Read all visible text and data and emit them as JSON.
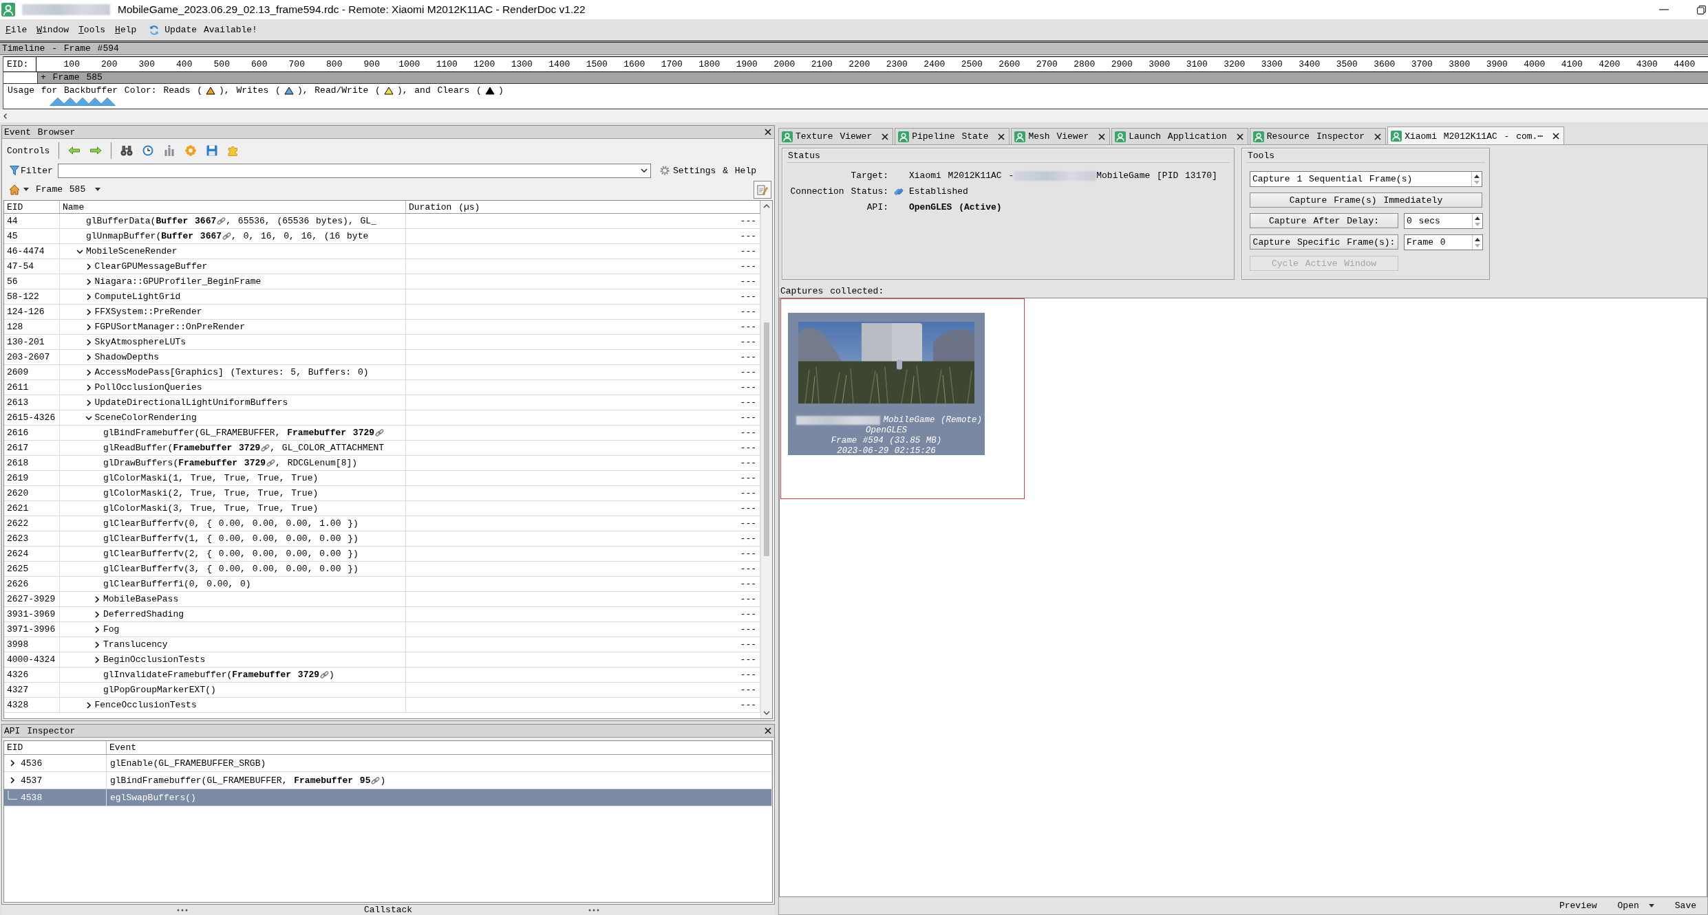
{
  "window": {
    "title": "MobileGame_2023.06.29_02.13_frame594.rdc - Remote: Xiaomi M2012K11AC - RenderDoc v1.22"
  },
  "menu": [
    "File",
    "Window",
    "Tools",
    "Help"
  ],
  "update_notice": "Update Available!",
  "timeline": {
    "title": "Timeline - Frame #594",
    "axis_label": "EID:",
    "ticks": [
      "100",
      "200",
      "300",
      "400",
      "500",
      "600",
      "700",
      "800",
      "900",
      "1000",
      "1100",
      "1200",
      "1300",
      "1400",
      "1500",
      "1600",
      "1700",
      "1800",
      "1900",
      "2000",
      "2100",
      "2200",
      "2300",
      "2400",
      "2500",
      "2600",
      "2700",
      "2800",
      "2900",
      "3000",
      "3100",
      "3200",
      "3300",
      "3400",
      "3500",
      "3600",
      "3700",
      "3800",
      "3900",
      "4000",
      "4100",
      "4200",
      "4300",
      "4400"
    ],
    "frame_label": "+ Frame 585",
    "usage": [
      {
        "kind": "text",
        "text": "Usage for Backbuffer Color: Reads ("
      },
      {
        "kind": "marker",
        "color": "#e8a01c"
      },
      {
        "kind": "text",
        "text": "), Writes ("
      },
      {
        "kind": "marker",
        "color": "#58a6df"
      },
      {
        "kind": "text",
        "text": "), Read/Write ("
      },
      {
        "kind": "marker",
        "color": "#f2e23a"
      },
      {
        "kind": "text",
        "text": "), and Clears ("
      },
      {
        "kind": "marker",
        "color": "#000000"
      },
      {
        "kind": "text",
        "text": ")"
      }
    ]
  },
  "event_browser": {
    "title": "Event Browser",
    "controls_label": "Controls",
    "filter_label": "Filter",
    "settings_label": "Settings & Help",
    "frame_label": "Frame 585",
    "columns": [
      "EID",
      "Name",
      "Duration (µs)"
    ],
    "rows": [
      {
        "eid": "44",
        "kind": "call",
        "selected": false,
        "duration": "---",
        "name": [
          {
            "kind": "text",
            "text": "glBufferData("
          },
          {
            "kind": "resource",
            "text": "Buffer 3667"
          },
          {
            "kind": "text",
            "text": ", 65536, (65536 bytes), GL_"
          }
        ]
      },
      {
        "eid": "45",
        "kind": "call",
        "selected": false,
        "duration": "---",
        "name": [
          {
            "kind": "text",
            "text": "glUnmapBuffer("
          },
          {
            "kind": "resource",
            "text": "Buffer 3667"
          },
          {
            "kind": "text",
            "text": ", 0, 16, 0, 16, (16 byte"
          }
        ]
      },
      {
        "eid": "46-4474",
        "kind": "marker",
        "expanded": true,
        "selected": false,
        "duration": "---",
        "name": [
          {
            "kind": "text",
            "text": "MobileSceneRender"
          }
        ],
        "children": [
          {
            "eid": "47-54",
            "kind": "marker",
            "expanded": false,
            "selected": false,
            "duration": "---",
            "name": [
              {
                "kind": "text",
                "text": "ClearGPUMessageBuffer"
              }
            ]
          },
          {
            "eid": "56",
            "kind": "marker",
            "expanded": false,
            "selected": false,
            "duration": "---",
            "name": [
              {
                "kind": "text",
                "text": "Niagara::GPUProfiler_BeginFrame"
              }
            ]
          },
          {
            "eid": "58-122",
            "kind": "marker",
            "expanded": false,
            "selected": false,
            "duration": "---",
            "name": [
              {
                "kind": "text",
                "text": "ComputeLightGrid"
              }
            ]
          },
          {
            "eid": "124-126",
            "kind": "marker",
            "expanded": false,
            "selected": false,
            "duration": "---",
            "name": [
              {
                "kind": "text",
                "text": "FFXSystem::PreRender"
              }
            ]
          },
          {
            "eid": "128",
            "kind": "marker",
            "expanded": false,
            "selected": false,
            "duration": "---",
            "name": [
              {
                "kind": "text",
                "text": "FGPUSortManager::OnPreRender"
              }
            ]
          },
          {
            "eid": "130-201",
            "kind": "marker",
            "expanded": false,
            "selected": false,
            "duration": "---",
            "name": [
              {
                "kind": "text",
                "text": "SkyAtmosphereLUTs"
              }
            ]
          },
          {
            "eid": "203-2607",
            "kind": "marker",
            "expanded": false,
            "selected": false,
            "duration": "---",
            "name": [
              {
                "kind": "text",
                "text": "ShadowDepths"
              }
            ]
          },
          {
            "eid": "2609",
            "kind": "marker",
            "expanded": false,
            "selected": false,
            "duration": "---",
            "name": [
              {
                "kind": "text",
                "text": "AccessModePass[Graphics] (Textures: 5, Buffers: 0)"
              }
            ]
          },
          {
            "eid": "2611",
            "kind": "marker",
            "expanded": false,
            "selected": false,
            "duration": "---",
            "name": [
              {
                "kind": "text",
                "text": "PollOcclusionQueries"
              }
            ]
          },
          {
            "eid": "2613",
            "kind": "marker",
            "expanded": false,
            "selected": false,
            "duration": "---",
            "name": [
              {
                "kind": "text",
                "text": "UpdateDirectionalLightUniformBuffers"
              }
            ]
          },
          {
            "eid": "2615-4326",
            "kind": "marker",
            "expanded": true,
            "selected": false,
            "duration": "---",
            "name": [
              {
                "kind": "text",
                "text": "SceneColorRendering"
              }
            ],
            "children": [
              {
                "eid": "2616",
                "kind": "call",
                "selected": false,
                "duration": "---",
                "name": [
                  {
                    "kind": "text",
                    "text": "glBindFramebuffer(GL_FRAMEBUFFER, "
                  },
                  {
                    "kind": "resource",
                    "text": "Framebuffer 3729"
                  }
                ]
              },
              {
                "eid": "2617",
                "kind": "call",
                "selected": false,
                "duration": "---",
                "name": [
                  {
                    "kind": "text",
                    "text": "glReadBuffer("
                  },
                  {
                    "kind": "resource",
                    "text": "Framebuffer 3729"
                  },
                  {
                    "kind": "text",
                    "text": ", GL_COLOR_ATTACHMENT"
                  }
                ]
              },
              {
                "eid": "2618",
                "kind": "call",
                "selected": false,
                "duration": "---",
                "name": [
                  {
                    "kind": "text",
                    "text": "glDrawBuffers("
                  },
                  {
                    "kind": "resource",
                    "text": "Framebuffer 3729"
                  },
                  {
                    "kind": "text",
                    "text": ", RDCGLenum[8])"
                  }
                ]
              },
              {
                "eid": "2619",
                "kind": "call",
                "selected": false,
                "duration": "---",
                "name": [
                  {
                    "kind": "text",
                    "text": "glColorMaski(1, True, True, True, True)"
                  }
                ]
              },
              {
                "eid": "2620",
                "kind": "call",
                "selected": false,
                "duration": "---",
                "name": [
                  {
                    "kind": "text",
                    "text": "glColorMaski(2, True, True, True, True)"
                  }
                ]
              },
              {
                "eid": "2621",
                "kind": "call",
                "selected": false,
                "duration": "---",
                "name": [
                  {
                    "kind": "text",
                    "text": "glColorMaski(3, True, True, True, True)"
                  }
                ]
              },
              {
                "eid": "2622",
                "kind": "call",
                "selected": false,
                "duration": "---",
                "name": [
                  {
                    "kind": "text",
                    "text": "glClearBufferfv(0, { 0.00, 0.00, 0.00, 1.00 })"
                  }
                ]
              },
              {
                "eid": "2623",
                "kind": "call",
                "selected": false,
                "duration": "---",
                "name": [
                  {
                    "kind": "text",
                    "text": "glClearBufferfv(1, { 0.00, 0.00, 0.00, 0.00 })"
                  }
                ]
              },
              {
                "eid": "2624",
                "kind": "call",
                "selected": false,
                "duration": "---",
                "name": [
                  {
                    "kind": "text",
                    "text": "glClearBufferfv(2, { 0.00, 0.00, 0.00, 0.00 })"
                  }
                ]
              },
              {
                "eid": "2625",
                "kind": "call",
                "selected": false,
                "duration": "---",
                "name": [
                  {
                    "kind": "text",
                    "text": "glClearBufferfv(3, { 0.00, 0.00, 0.00, 0.00 })"
                  }
                ]
              },
              {
                "eid": "2626",
                "kind": "call",
                "selected": false,
                "duration": "---",
                "name": [
                  {
                    "kind": "text",
                    "text": "glClearBufferfi(0, 0.00, 0)"
                  }
                ]
              },
              {
                "eid": "2627-3929",
                "kind": "marker",
                "expanded": false,
                "selected": false,
                "duration": "---",
                "name": [
                  {
                    "kind": "text",
                    "text": "MobileBasePass"
                  }
                ]
              },
              {
                "eid": "3931-3969",
                "kind": "marker",
                "expanded": false,
                "selected": false,
                "duration": "---",
                "name": [
                  {
                    "kind": "text",
                    "text": "DeferredShading"
                  }
                ]
              },
              {
                "eid": "3971-3996",
                "kind": "marker",
                "expanded": false,
                "selected": false,
                "duration": "---",
                "name": [
                  {
                    "kind": "text",
                    "text": "Fog"
                  }
                ]
              },
              {
                "eid": "3998",
                "kind": "marker",
                "expanded": false,
                "selected": false,
                "duration": "---",
                "name": [
                  {
                    "kind": "text",
                    "text": "Translucency"
                  }
                ]
              },
              {
                "eid": "4000-4324",
                "kind": "marker",
                "expanded": false,
                "selected": false,
                "duration": "---",
                "name": [
                  {
                    "kind": "text",
                    "text": "BeginOcclusionTests"
                  }
                ]
              },
              {
                "eid": "4326",
                "kind": "call",
                "selected": false,
                "duration": "---",
                "name": [
                  {
                    "kind": "text",
                    "text": "glInvalidateFramebuffer("
                  },
                  {
                    "kind": "resource",
                    "text": "Framebuffer 3729"
                  },
                  {
                    "kind": "text",
                    "text": ")"
                  }
                ]
              },
              {
                "eid": "4327",
                "kind": "call",
                "selected": false,
                "duration": "---",
                "name": [
                  {
                    "kind": "text",
                    "text": "glPopGroupMarkerEXT()"
                  }
                ]
              }
            ]
          },
          {
            "eid": "4328",
            "kind": "marker",
            "expanded": false,
            "selected": false,
            "duration": "---",
            "name": [
              {
                "kind": "text",
                "text": "FenceOcclusionTests"
              }
            ]
          }
        ]
      }
    ]
  },
  "api_inspector": {
    "title": "API Inspector",
    "columns": [
      "EID",
      "Event"
    ],
    "rows": [
      {
        "eid": "4536",
        "kind": "expandable",
        "expanded": false,
        "selected": false,
        "event": [
          {
            "kind": "text",
            "text": "glEnable(GL_FRAMEBUFFER_SRGB)"
          }
        ]
      },
      {
        "eid": "4537",
        "kind": "expandable",
        "expanded": false,
        "selected": false,
        "event": [
          {
            "kind": "text",
            "text": "glBindFramebuffer(GL_FRAMEBUFFER, "
          },
          {
            "kind": "resource",
            "text": "Framebuffer 95"
          },
          {
            "kind": "text",
            "text": ")"
          }
        ]
      },
      {
        "eid": "4538",
        "kind": "leaf",
        "selected": true,
        "event": [
          {
            "kind": "text",
            "text": "eglSwapBuffers()"
          }
        ]
      }
    ]
  },
  "callstack": {
    "title": "Callstack"
  },
  "tabs": [
    {
      "label": "Texture Viewer",
      "selected": false
    },
    {
      "label": "Pipeline State",
      "selected": false
    },
    {
      "label": "Mesh Viewer",
      "selected": false
    },
    {
      "label": "Launch Application",
      "selected": false
    },
    {
      "label": "Resource Inspector",
      "selected": false
    },
    {
      "label": "Xiaomi M2012K11AC - com.⋯",
      "selected": true
    }
  ],
  "remote": {
    "status": {
      "title": "Status",
      "fields": [
        {
          "kind": "target",
          "label": "Target:",
          "value": "Xiaomi M2012K11AC -",
          "value_end": "MobileGame [PID 13170]"
        },
        {
          "kind": "connection",
          "label": "Connection Status:",
          "value": "Established"
        },
        {
          "kind": "api",
          "label": "API:",
          "value": "OpenGLES (Active)"
        }
      ]
    },
    "tools": {
      "title": "Tools",
      "items": [
        {
          "kind": "spin",
          "value": "Capture 1 Sequential Frame(s)",
          "disabled": false
        },
        {
          "kind": "button",
          "label": "Capture Frame(s) Immediately",
          "disabled": false
        },
        {
          "kind": "button_spin",
          "label": "Capture After Delay:",
          "value": "0 secs",
          "disabled": false
        },
        {
          "kind": "button_spin",
          "label": "Capture Specific Frame(s):",
          "value": "Frame 0",
          "disabled": false
        },
        {
          "kind": "button",
          "label": "Cycle Active Window",
          "disabled": true
        }
      ]
    },
    "captures": {
      "label": "Captures collected:",
      "items": [
        {
          "selected": true,
          "title": "MobileGame (Remote)",
          "api": "OpenGLES",
          "frame": "Frame #594 (33.85 MB)",
          "time": "2023-06-29 02:15:26"
        }
      ]
    },
    "buttons": [
      {
        "label": "Preview",
        "dropdown": false
      },
      {
        "label": "Open",
        "dropdown": true
      },
      {
        "label": "Save",
        "dropdown": false
      }
    ]
  }
}
